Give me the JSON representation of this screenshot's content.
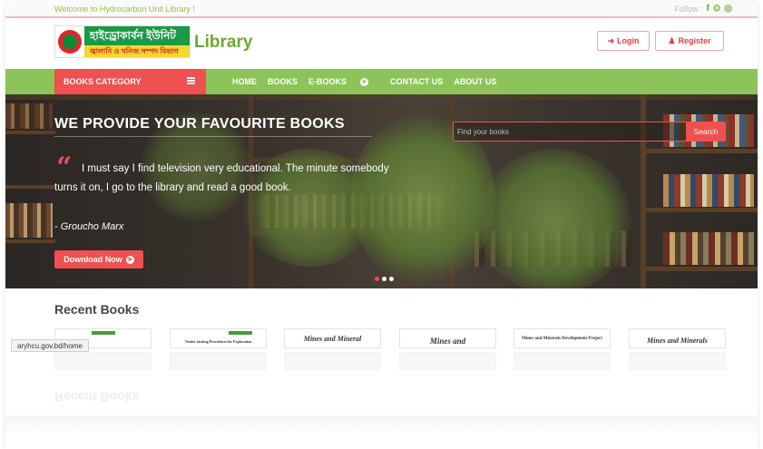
{
  "topbar": {
    "welcome": "Welcome to Hydrocarbon Unit Library !",
    "follow_label": "Follow :",
    "social": [
      {
        "icon": "facebook-icon",
        "glyph": "f"
      },
      {
        "icon": "github-icon",
        "glyph": "⊙"
      },
      {
        "icon": "instagram-icon",
        "glyph": "◎"
      }
    ]
  },
  "header": {
    "logo_line1": "হাইড্রোকার্বন ইউনিট",
    "logo_line2": "জ্বালানি ও খনিজ সম্পদ বিভাগ",
    "brand": "Library",
    "login_label": "Login",
    "register_label": "Register"
  },
  "nav": {
    "category_label": "BOOKS CATEGORY",
    "links": [
      "HOME",
      "BOOKS",
      "E-BOOKS",
      "CONTACT US",
      "ABOUT US"
    ]
  },
  "hero": {
    "title": "WE PROVIDE YOUR FAVOURITE BOOKS",
    "quote": "I must say I find television very educational. The minute somebody turns it on, I go to the library and read a good book.",
    "author": "- Groucho Marx",
    "download_label": "Download Now",
    "search_placeholder": "Find your books",
    "search_button": "Search",
    "slides": 3,
    "active_slide": 1
  },
  "recent": {
    "title": "Recent Books",
    "books": [
      {
        "title": ""
      },
      {
        "title": "Tender inviting Procedures for Exploration"
      },
      {
        "title": "Mines and Mineral"
      },
      {
        "title": "Mines and"
      },
      {
        "title": "Mines and Minerals Development Project"
      },
      {
        "title": "Mines and Minerals"
      }
    ]
  },
  "statusbar": {
    "url": "aryhcu.gov.bd/home"
  },
  "colors": {
    "accent_red": "#ef5050",
    "nav_green": "#8cc45a",
    "brand_green": "#6aa82f"
  }
}
